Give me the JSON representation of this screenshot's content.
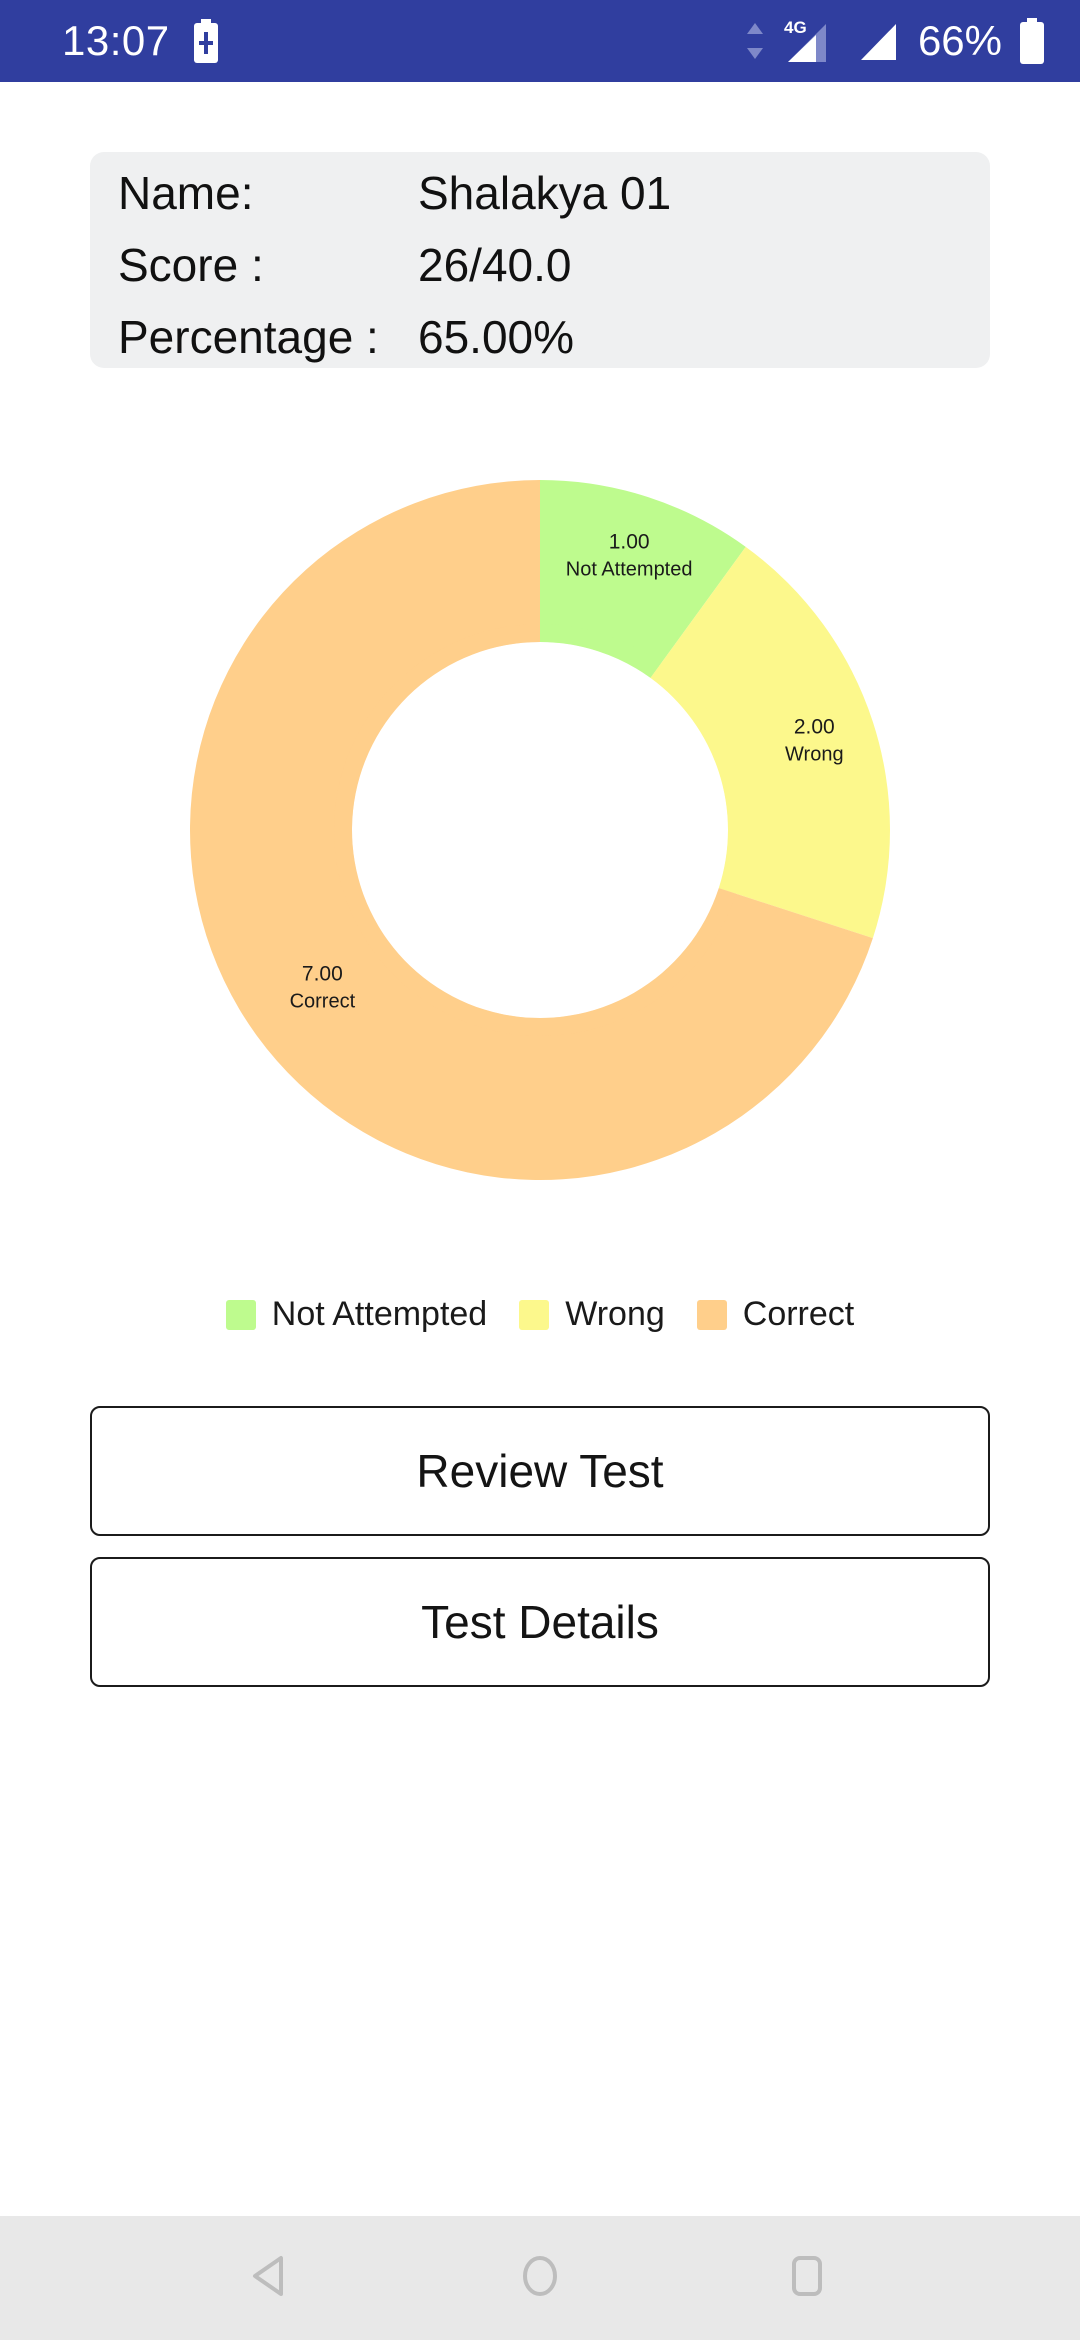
{
  "status_bar": {
    "time": "13:07",
    "battery_percent": "66%",
    "network_type": "4G",
    "icons": [
      "charging-battery-icon",
      "data-transfer-icon",
      "signal-4g-icon",
      "signal-icon",
      "battery-icon"
    ],
    "background_color": "#303E9F",
    "text_color": "#FFFFFF"
  },
  "result_card": {
    "background_color": "#EFF0F1",
    "rows": [
      {
        "key": "Name:",
        "value": "Shalakya 01"
      },
      {
        "key": "Score :",
        "value": "26/40.0"
      },
      {
        "key": "Percentage :",
        "value": "65.00%"
      }
    ]
  },
  "chart_data": {
    "type": "pie",
    "variant": "donut",
    "title": "",
    "total": 10,
    "start_angle_deg": 0,
    "direction": "clockwise",
    "legend_position": "bottom",
    "grid": false,
    "categories": [
      "Not Attempted",
      "Wrong",
      "Correct"
    ],
    "values": [
      1.0,
      2.0,
      7.0
    ],
    "value_labels": [
      "1.00",
      "2.00",
      "7.00"
    ],
    "colors": [
      "#BEFB8E",
      "#FCF88C",
      "#FFCF8B"
    ],
    "slices": [
      {
        "name": "Not Attempted",
        "value": 1.0,
        "label": "1.00",
        "color": "#BEFB8E",
        "percent": 10,
        "start_deg": 0,
        "end_deg": 36
      },
      {
        "name": "Wrong",
        "value": 2.0,
        "label": "2.00",
        "color": "#FCF88C",
        "percent": 20,
        "start_deg": 36,
        "end_deg": 108
      },
      {
        "name": "Correct",
        "value": 7.0,
        "label": "7.00",
        "color": "#FFCF8B",
        "percent": 70,
        "start_deg": 108,
        "end_deg": 360
      }
    ]
  },
  "legend": {
    "items": [
      {
        "label": "Not Attempted",
        "color": "#BEFB8E"
      },
      {
        "label": "Wrong",
        "color": "#FCF88C"
      },
      {
        "label": "Correct",
        "color": "#FFCF8B"
      }
    ]
  },
  "buttons": {
    "review_test": "Review Test",
    "test_details": "Test Details"
  },
  "nav_bar": {
    "back": "back-icon",
    "home": "home-icon",
    "recents": "recents-icon",
    "background_color": "#E8E8E8",
    "icon_color": "#BDBDBD"
  }
}
